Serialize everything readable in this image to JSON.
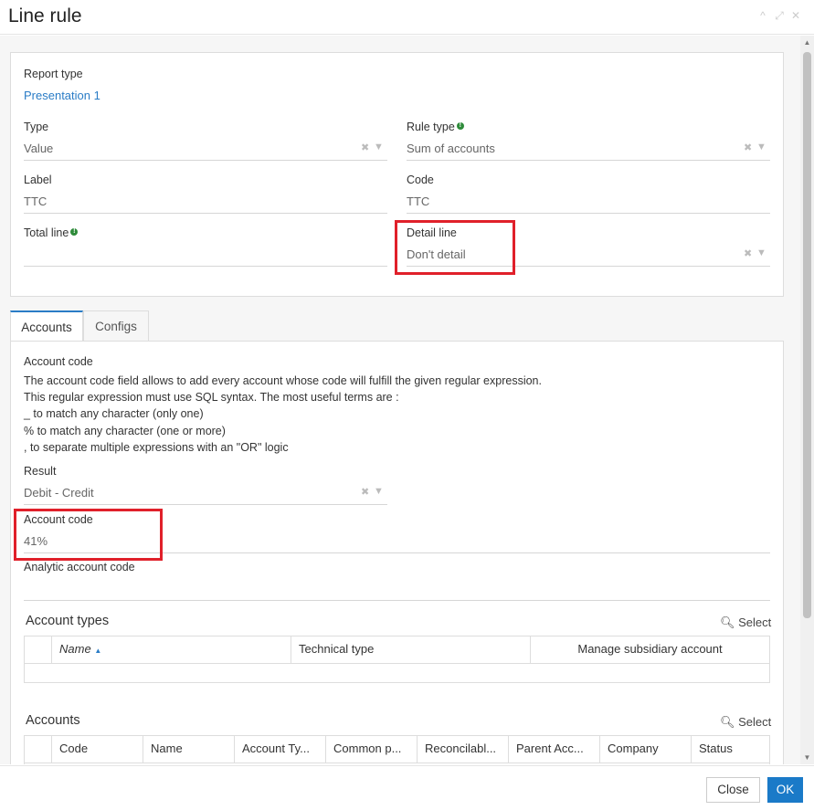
{
  "window": {
    "title": "Line rule"
  },
  "form": {
    "report_type": {
      "label": "Report type",
      "value": "Presentation 1"
    },
    "type": {
      "label": "Type",
      "value": "Value"
    },
    "rule_type": {
      "label": "Rule type",
      "value": "Sum of accounts"
    },
    "label": {
      "label": "Label",
      "value": "TTC"
    },
    "code": {
      "label": "Code",
      "value": "TTC"
    },
    "total_line": {
      "label": "Total line",
      "value": ""
    },
    "detail_line": {
      "label": "Detail line",
      "value": "Don't detail"
    }
  },
  "tabs": [
    {
      "label": "Accounts",
      "active": true
    },
    {
      "label": "Configs",
      "active": false
    }
  ],
  "accounts_tab": {
    "heading": "Account code",
    "description": [
      "The account code field allows to add every account whose code will fulfill the given regular expression.",
      "This regular expression must use SQL syntax. The most useful terms are :",
      "_ to match any character (only one)",
      "% to match any character (one or more)",
      ", to separate multiple expressions with an \"OR\" logic"
    ],
    "result": {
      "label": "Result",
      "value": "Debit - Credit"
    },
    "account_code": {
      "label": "Account code",
      "value": "41%"
    },
    "analytic_account_code": {
      "label": "Analytic account code",
      "value": ""
    },
    "account_types": {
      "title": "Account types",
      "select_label": "Select",
      "columns": [
        "Name",
        "Technical type",
        "Manage subsidiary account"
      ]
    },
    "accounts": {
      "title": "Accounts",
      "select_label": "Select",
      "columns": [
        "Code",
        "Name",
        "Account Ty...",
        "Common p...",
        "Reconcilabl...",
        "Parent Acc...",
        "Company",
        "Status"
      ]
    }
  },
  "footer": {
    "close_label": "Close",
    "ok_label": "OK"
  },
  "colors": {
    "accent": "#1a7ac8",
    "highlight": "#e0202a",
    "info": "#2e8b3a"
  }
}
